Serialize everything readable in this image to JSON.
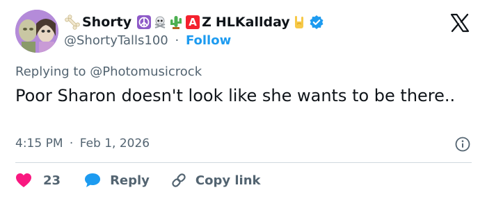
{
  "author": {
    "display_name": "Shorty",
    "badge_letters": [
      "A",
      "Z"
    ],
    "name_suffix": "HLKallday",
    "handle": "@ShortyTalls100",
    "separator": "·",
    "follow_label": "Follow",
    "verified": true
  },
  "reply_context": {
    "prefix": "Replying to",
    "mention": "@Photomusicrock"
  },
  "tweet": {
    "text": "Poor Sharon doesn't look like she wants to be there..",
    "time": "4:15 PM",
    "separator": "·",
    "date": "Feb 1, 2026"
  },
  "actions": {
    "like_count": "23",
    "reply_label": "Reply",
    "copy_link_label": "Copy link"
  },
  "icons": {
    "platform": "x-logo-icon",
    "info": "info-icon",
    "like": "heart-icon",
    "reply": "speech-bubble-icon",
    "copy_link": "link-icon"
  },
  "colors": {
    "link_blue": "#1d9bf0",
    "secondary_text": "#536471",
    "like_red": "#f91880",
    "verified_blue": "#1d9bf0",
    "badge_red": "#f4212e"
  }
}
